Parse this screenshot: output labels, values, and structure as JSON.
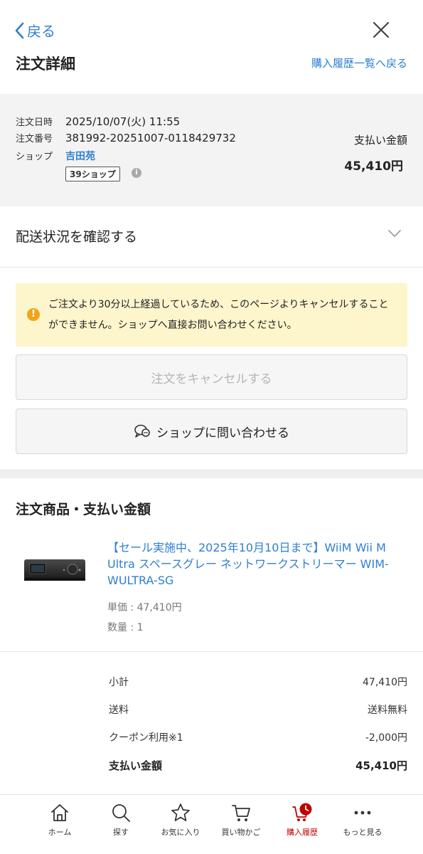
{
  "header": {
    "back_label": "戻る",
    "title": "注文詳細",
    "history_link": "購入履歴一覧へ戻る"
  },
  "order": {
    "date_label": "注文日時",
    "date_value": "2025/10/07(火) 11:55",
    "number_label": "注文番号",
    "number_value": "381992-20251007-0118429732",
    "shop_label": "ショップ",
    "shop_name": "吉田苑",
    "shop_badge": "39ショップ",
    "info_symbol": "i",
    "payment_label": "支払い金額",
    "payment_amount": "45,410円"
  },
  "shipping": {
    "label": "配送状況を確認する"
  },
  "notice": {
    "icon_symbol": "!",
    "text": "ご注文より30分以上経過しているため、このページよりキャンセルすることができません。ショップへ直接お問い合わせください。"
  },
  "buttons": {
    "cancel_label": "注文をキャンセルする",
    "contact_label": "ショップに問い合わせる"
  },
  "products": {
    "section_title": "注文商品・支払い金額",
    "items": [
      {
        "name": "【セール実施中、2025年10月10日まで】WiiM Wii M Ultra スペースグレー ネットワークストリーマー WIM-WULTRA-SG",
        "unit_price": "単価 : 47,410円",
        "quantity": "数量 : 1"
      }
    ]
  },
  "summary": {
    "rows": [
      {
        "label": "小計",
        "value": "47,410円"
      },
      {
        "label": "送料",
        "value": "送料無料"
      },
      {
        "label": "クーポン利用※1",
        "value": "-2,000円"
      },
      {
        "label": "支払い金額",
        "value": "45,410円"
      }
    ]
  },
  "tabbar": {
    "tabs": [
      {
        "label": "ホーム",
        "icon": "home-icon"
      },
      {
        "label": "探す",
        "icon": "search-icon"
      },
      {
        "label": "お気に入り",
        "icon": "star-icon"
      },
      {
        "label": "買い物かご",
        "icon": "cart-icon"
      },
      {
        "label": "購入履歴",
        "icon": "history-cart-icon",
        "active": true
      },
      {
        "label": "もっと見る",
        "icon": "more-icon"
      }
    ]
  },
  "colors": {
    "link": "#2f7fd0",
    "accent": "#bf0000",
    "notice_bg": "#fdf5cc",
    "warning": "#f0a51a"
  }
}
